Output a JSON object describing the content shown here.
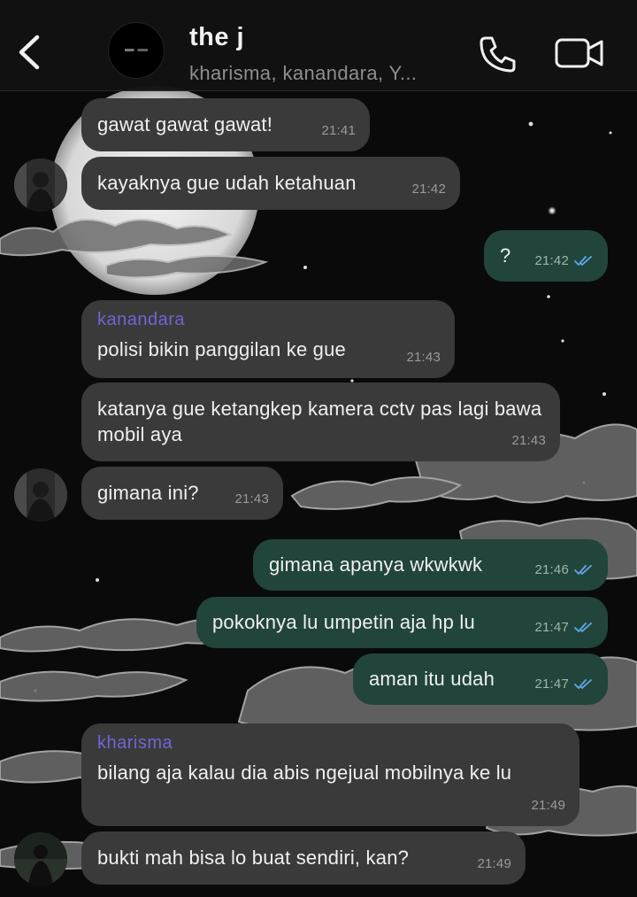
{
  "header": {
    "title": "the j",
    "subtitle": "kharisma, kanandara, Y..."
  },
  "colors": {
    "incoming_bubble": "#3a3a3a",
    "outgoing_bubble": "#21453a",
    "sender_name": "#6e66d6",
    "read_ticks": "#5fa8e8"
  },
  "icons": {
    "back": "chevron-left-icon",
    "call": "phone-icon",
    "video": "video-camera-icon",
    "read": "double-check-icon"
  },
  "messages": [
    {
      "dir": "in",
      "text": "gawat gawat gawat!",
      "time": "21:41"
    },
    {
      "dir": "in",
      "text": "kayaknya gue udah ketahuan",
      "time": "21:42"
    },
    {
      "dir": "out",
      "text": "?",
      "time": "21:42",
      "read": true
    },
    {
      "dir": "in",
      "sender": "kanandara",
      "text": "polisi bikin panggilan ke gue",
      "time": "21:43"
    },
    {
      "dir": "in",
      "text": "katanya gue ketangkep kamera cctv pas lagi bawa mobil aya",
      "time": "21:43"
    },
    {
      "dir": "in",
      "text": "gimana ini?",
      "time": "21:43"
    },
    {
      "dir": "out",
      "text": "gimana apanya wkwkwk",
      "time": "21:46",
      "read": true
    },
    {
      "dir": "out",
      "text": "pokoknya lu umpetin aja hp lu",
      "time": "21:47",
      "read": true
    },
    {
      "dir": "out",
      "text": "aman itu udah",
      "time": "21:47",
      "read": true
    },
    {
      "dir": "in",
      "sender": "kharisma",
      "text": "bilang aja kalau dia abis ngejual mobilnya ke lu",
      "time": "21:49"
    },
    {
      "dir": "in",
      "text": "bukti mah bisa lo buat sendiri, kan?",
      "time": "21:49"
    }
  ]
}
